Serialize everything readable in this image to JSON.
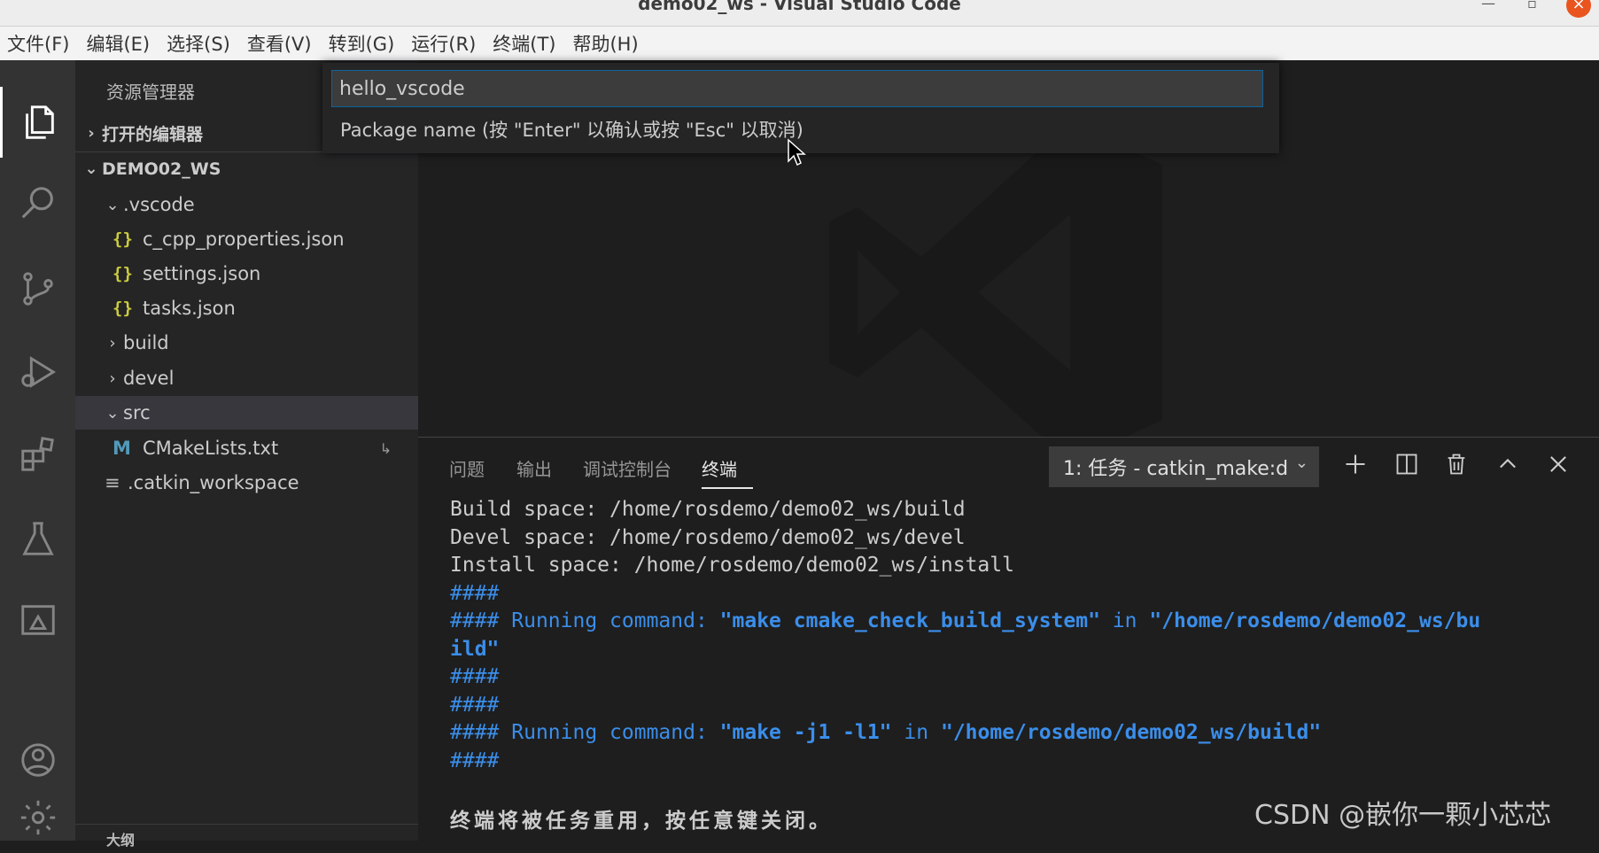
{
  "window": {
    "title": "demo02_ws - Visual Studio Code",
    "minimize": "—",
    "maximize": "▫",
    "close": "×"
  },
  "menu": [
    "文件(F)",
    "编辑(E)",
    "选择(S)",
    "查看(V)",
    "转到(G)",
    "运行(R)",
    "终端(T)",
    "帮助(H)"
  ],
  "activity_icons": [
    "explorer-icon",
    "search-icon",
    "source-control-icon",
    "run-debug-icon",
    "extensions-icon",
    "testing-icon",
    "remote-explorer-icon",
    "account-icon",
    "gear-icon"
  ],
  "sidebar": {
    "title": "资源管理器",
    "open_editors": "打开的编辑器",
    "workspace": "DEMO02_WS",
    "tree": [
      {
        "label": ".vscode",
        "kind": "folder-open"
      },
      {
        "label": "c_cpp_properties.json",
        "kind": "json"
      },
      {
        "label": "settings.json",
        "kind": "json"
      },
      {
        "label": "tasks.json",
        "kind": "json"
      },
      {
        "label": "build",
        "kind": "folder"
      },
      {
        "label": "devel",
        "kind": "folder"
      },
      {
        "label": "src",
        "kind": "folder-open"
      },
      {
        "label": "CMakeLists.txt",
        "kind": "cmake"
      },
      {
        "label": ".catkin_workspace",
        "kind": "file"
      }
    ],
    "json_icon": "{}",
    "cmake_icon": "M",
    "file_icon": "≡",
    "cmake_badge": "↳",
    "outline": "大纲"
  },
  "quick_input": {
    "value": "hello_vscode",
    "message": "Package name (按 \"Enter\" 以确认或按 \"Esc\" 以取消)"
  },
  "panel": {
    "tabs": [
      "问题",
      "输出",
      "调试控制台",
      "终端"
    ],
    "active_tab": "终端",
    "terminal_select": "1: 任务 - catkin_make:d",
    "actions": [
      "add-terminal-icon",
      "split-terminal-icon",
      "trash-icon",
      "maximize-panel-icon",
      "close-panel-icon"
    ]
  },
  "terminal": {
    "space_lines": [
      "Build space: /home/rosdemo/demo02_ws/build",
      "Devel space: /home/rosdemo/demo02_ws/devel",
      "Install space: /home/rosdemo/demo02_ws/install"
    ],
    "hashes": "####",
    "running_label": "Running command:",
    "in_word": "in",
    "cmd1": "\"make cmake_check_build_system\"",
    "path1_a": "\"/home/rosdemo/demo02_ws/bu",
    "path1_b": "ild\"",
    "cmd2": "\"make -j1 -l1\"",
    "path2": "\"/home/rosdemo/demo02_ws/build\"",
    "final_message": "终端将被任务重用，按任意键关闭。"
  },
  "watermark": "CSDN @嵌你一颗小芯芯"
}
